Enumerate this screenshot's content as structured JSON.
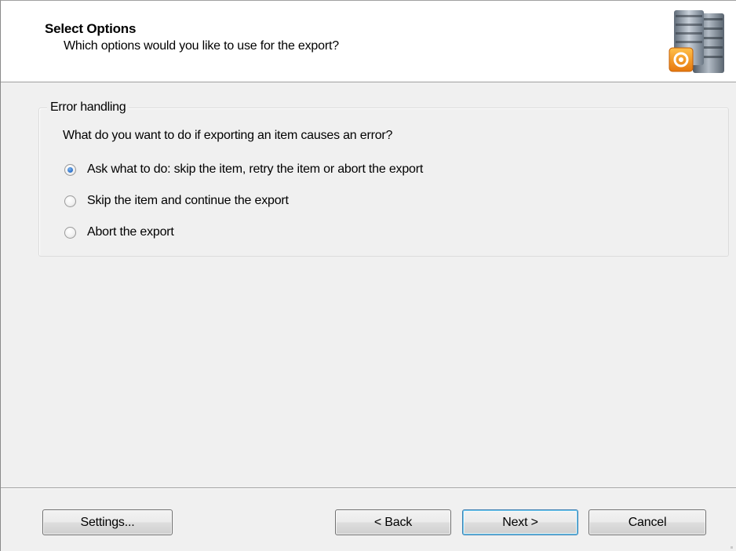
{
  "header": {
    "title": "Select Options",
    "subtitle": "Which options would you like to use for the export?",
    "icon": "database-export-icon"
  },
  "error_handling": {
    "legend": "Error handling",
    "question": "What do you want to do if exporting an item causes an error?",
    "options": [
      {
        "label": "Ask what to do: skip the item, retry the item or abort the export",
        "checked": true
      },
      {
        "label": "Skip the item and continue the export",
        "checked": false
      },
      {
        "label": "Abort the export",
        "checked": false
      }
    ]
  },
  "footer": {
    "settings_label": "Settings...",
    "back_label": "< Back",
    "next_label": "Next >",
    "cancel_label": "Cancel"
  },
  "colors": {
    "accent": "#3c7fb1",
    "icon_orange": "#f39c12"
  }
}
